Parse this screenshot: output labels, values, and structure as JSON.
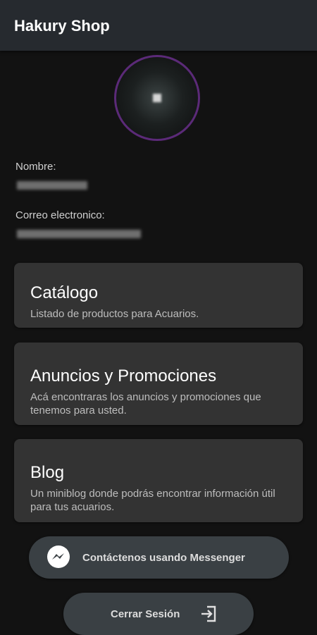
{
  "app_title": "Hakury Shop",
  "profile": {
    "name_label": "Nombre:",
    "email_label": "Correo electronico:"
  },
  "cards": [
    {
      "title": "Catálogo",
      "description": "Listado de productos para Acuarios."
    },
    {
      "title": "Anuncios y Promociones",
      "description": "Acá encontraras los anuncios y promociones que tenemos para usted."
    },
    {
      "title": "Blog",
      "description": "Un miniblog donde podrás encontrar información útil para tus acuarios."
    }
  ],
  "actions": {
    "messenger_label": "Contáctenos usando Messenger",
    "logout_label": "Cerrar Sesión"
  },
  "icons": {
    "messenger": "messenger-icon",
    "logout": "logout-icon"
  },
  "colors": {
    "background": "#121212",
    "appbar": "#262a2f",
    "card": "#333333",
    "pill": "#3a4044",
    "avatar_ring": "#5b2a78"
  }
}
